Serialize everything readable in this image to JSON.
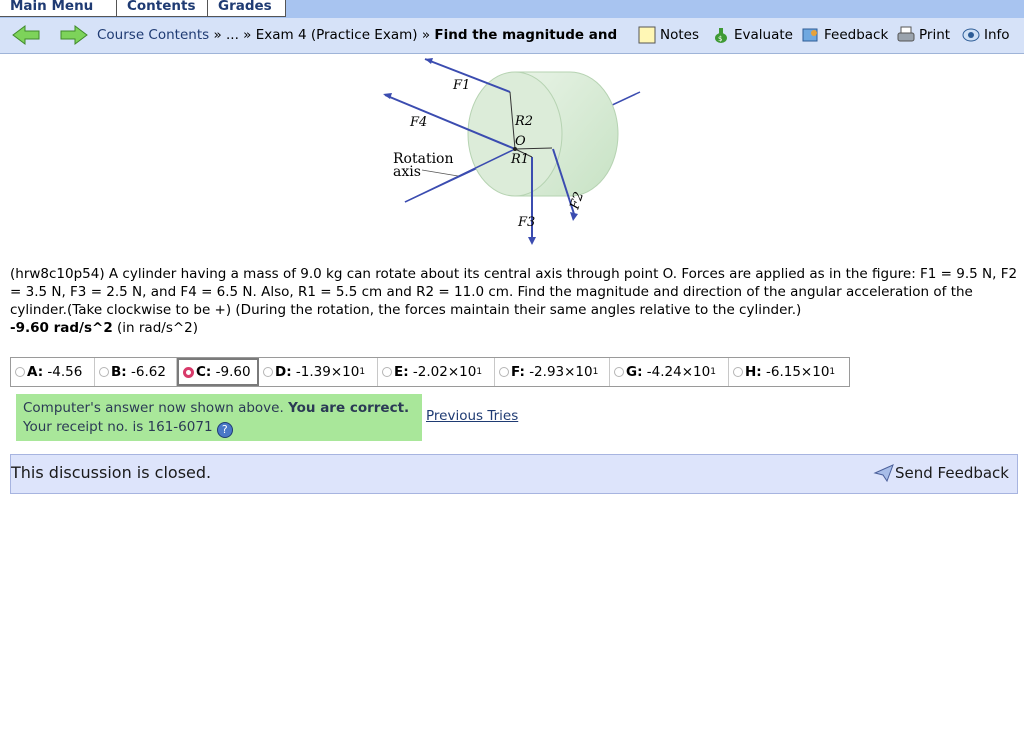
{
  "menu": {
    "tabs": [
      "Main Menu",
      "Contents",
      "Grades"
    ]
  },
  "nav": {
    "crumb_course": "Course Contents",
    "crumb_sep1": " » ... » ",
    "crumb_exam": "Exam 4 (Practice Exam)",
    "crumb_sep2": " » ",
    "crumb_current": "Find the magnitude and",
    "tools": {
      "notes": "Notes",
      "evaluate": "Evaluate",
      "feedback": "Feedback",
      "print": "Print",
      "info": "Info"
    }
  },
  "figure": {
    "labels": {
      "f1": "F1",
      "f4": "F4",
      "r2": "R2",
      "o": "O",
      "r1": "R1",
      "rotation": "Rotation",
      "axis": "axis",
      "f3": "F3",
      "f2": "F2"
    }
  },
  "problem": {
    "text": "(hrw8c10p54) A cylinder having a mass of 9.0 kg can rotate about its central axis through point O. Forces are applied as in the figure: F1 = 9.5 N, F2 = 3.5 N, F3 = 2.5 N, and F4 = 6.5 N. Also, R1 = 5.5 cm and R2 = 11.0 cm. Find the magnitude and direction of the angular acceleration of the cylinder.(Take clockwise to be +) (During the rotation, the forces maintain their same angles relative to the cylinder.)",
    "answer_value": "-9.60 rad/s^2",
    "answer_units": " (in rad/s^2)"
  },
  "choices": [
    {
      "letter": "A:",
      "value": "-4.56",
      "exp": ""
    },
    {
      "letter": "B:",
      "value": "-6.62",
      "exp": ""
    },
    {
      "letter": "C:",
      "value": "-9.60",
      "exp": ""
    },
    {
      "letter": "D:",
      "value": "-1.39×10",
      "exp": "1"
    },
    {
      "letter": "E:",
      "value": "-2.02×10",
      "exp": "1"
    },
    {
      "letter": "F:",
      "value": "-2.93×10",
      "exp": "1"
    },
    {
      "letter": "G:",
      "value": "-4.24×10",
      "exp": "1"
    },
    {
      "letter": "H:",
      "value": "-6.15×10",
      "exp": "1"
    }
  ],
  "selected_choice": "C",
  "result": {
    "line1_plain": "Computer's answer now shown above. ",
    "line1_bold": "You are correct.",
    "line2": "Your receipt no. is 161-6071 ",
    "previous_tries": "Previous Tries"
  },
  "discussion": {
    "message": "This discussion is closed.",
    "send_feedback": "Send Feedback"
  }
}
